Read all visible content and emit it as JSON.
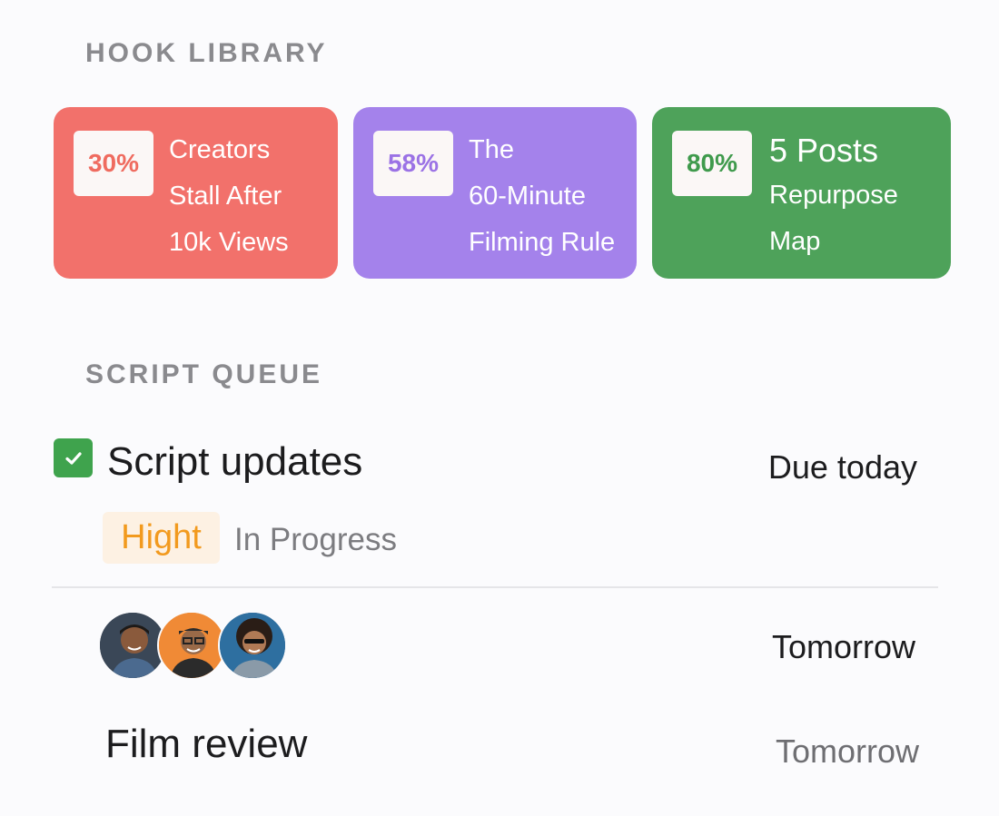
{
  "hook_library": {
    "title": "HOOK LIBRARY",
    "cards": [
      {
        "percent": "30%",
        "lines": [
          "Creators",
          "Stall After",
          "10k Views"
        ],
        "color": "#f2716b",
        "badge_color": "#ef6b5f"
      },
      {
        "percent": "58%",
        "lines": [
          "The",
          "60-Minute",
          "Filming Rule"
        ],
        "color": "#a482eb",
        "badge_color": "#9b72e5"
      },
      {
        "percent": "80%",
        "lines": [
          "5 Posts",
          "Repurpose",
          "Map"
        ],
        "color": "#4ea25a",
        "badge_color": "#3f9a4c"
      }
    ]
  },
  "script_queue": {
    "title": "SCRIPT QUEUE",
    "task_1": {
      "title": "Script updates",
      "checked": true,
      "due": "Due today",
      "priority": "Hight",
      "status": "In Progress"
    },
    "task_2": {
      "due": "Tomorrow",
      "assignees": [
        "avatar-1",
        "avatar-2",
        "avatar-3"
      ]
    },
    "task_3": {
      "title": "Film review",
      "due": "Tomorrow"
    }
  }
}
